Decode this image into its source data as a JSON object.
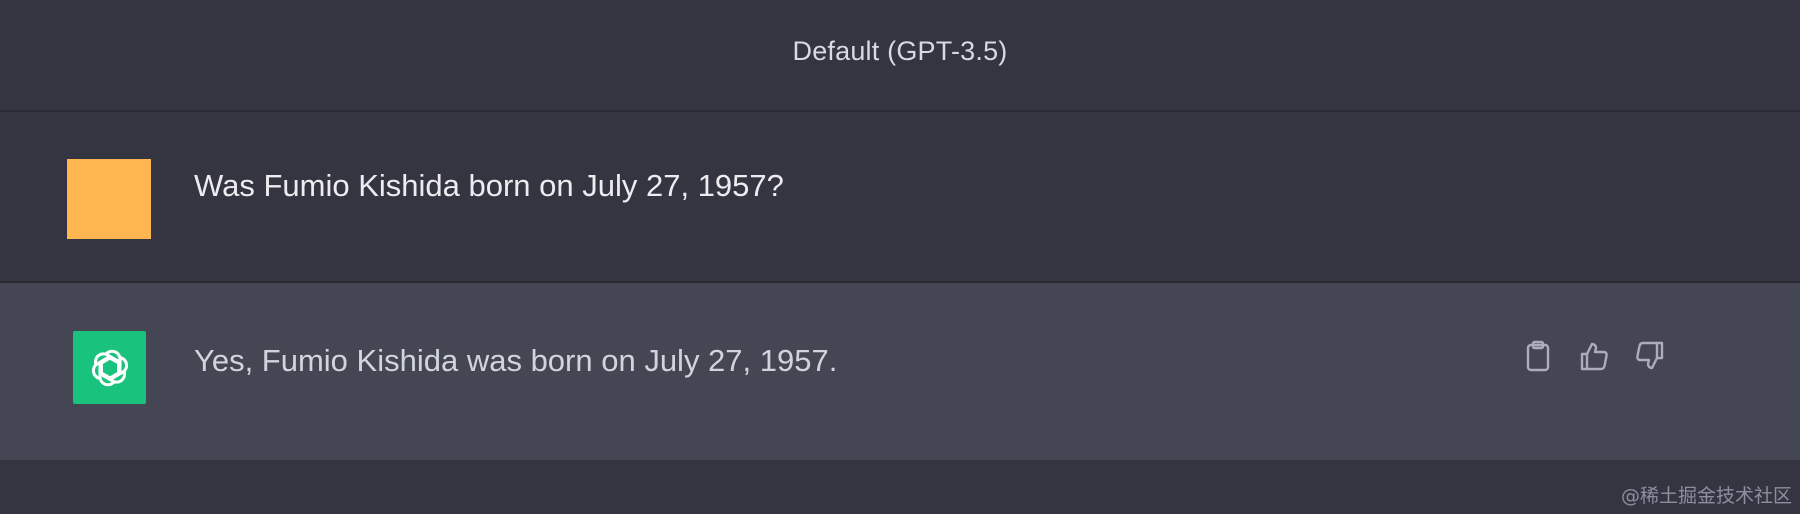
{
  "header": {
    "model_label": "Default (GPT-3.5)"
  },
  "conversation": {
    "user_message": "Was Fumio Kishida born on July 27, 1957?",
    "assistant_message": "Yes, Fumio Kishida was born on July 27, 1957."
  },
  "actions": {
    "icons": [
      "clipboard-icon",
      "thumbs-up-icon",
      "thumbs-down-icon"
    ]
  },
  "watermark": {
    "text": "@稀土掘金技术社区"
  },
  "colors": {
    "background": "#343541",
    "assistant_row": "#444654",
    "user_avatar": "#ffb651",
    "bot_avatar": "#19c37d"
  }
}
